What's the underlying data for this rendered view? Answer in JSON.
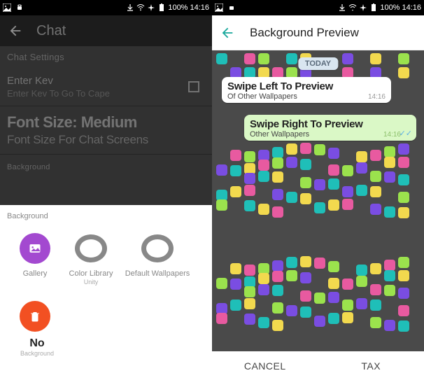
{
  "statusbar": {
    "battery": "100%",
    "time": "14:16"
  },
  "left": {
    "title": "Chat",
    "section_label": "Chat Settings",
    "enter_key": {
      "title": "Enter Kev",
      "sub": "Enter Kev To Go To Cape"
    },
    "font": {
      "title": "Font Size: Medium",
      "sub": "Font Size For Chat Screens"
    },
    "background_label": "Background",
    "sheet": {
      "title": "Background",
      "gallery": "Gallery",
      "color_library": "Color Library",
      "unity": "Unity",
      "default_wallpapers": "Default Wallpapers",
      "no": "No",
      "no_sub": "Background"
    }
  },
  "right": {
    "title": "Background Preview",
    "date": "TODAY",
    "msg_in": {
      "title": "Swipe Left To Preview",
      "sub": "Of Other Wallpapers",
      "time": "14:16"
    },
    "msg_out": {
      "title": "Swipe Right To Preview",
      "sub": "Other Wallpapers",
      "time": "14:16"
    },
    "cancel": "CANCEL",
    "set": "TAX"
  },
  "colors": {
    "teal": "#1fbfb8",
    "yellow": "#f2d94e",
    "pink": "#e85aa0",
    "green": "#9be24d",
    "purple": "#7a4de2"
  }
}
